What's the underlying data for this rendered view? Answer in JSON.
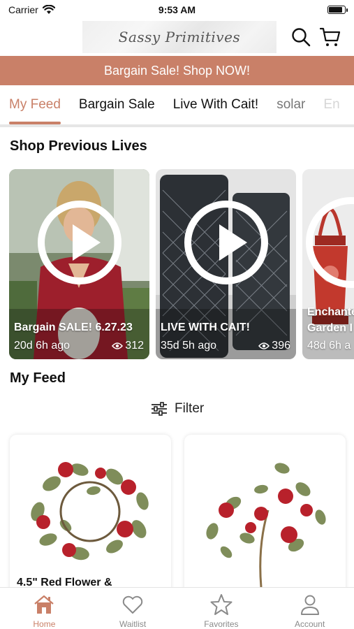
{
  "status_bar": {
    "carrier": "Carrier",
    "time": "9:53 AM",
    "battery_level": 0.9
  },
  "header": {
    "logo_text": "Sassy Primitives"
  },
  "banner": {
    "text": "Bargain Sale! Shop NOW!"
  },
  "tabs": [
    {
      "label": "My Feed",
      "active": true
    },
    {
      "label": "Bargain Sale"
    },
    {
      "label": "Live With Cait!"
    },
    {
      "label": "solar"
    },
    {
      "label": "En"
    }
  ],
  "previous_lives": {
    "title": "Shop Previous Lives",
    "items": [
      {
        "title": "Bargain SALE! 6.27.23",
        "age": "20d 6h ago",
        "views": "312"
      },
      {
        "title": "LIVE WITH CAIT!",
        "age": "35d 5h ago",
        "views": "396"
      },
      {
        "title": "Enchante",
        "title2": "Garden I",
        "age": "48d 6h a"
      }
    ]
  },
  "feed": {
    "title": "My Feed",
    "filter_label": "Filter",
    "products": [
      {
        "name": "4.5\" Red Flower &"
      },
      {
        "name": ""
      }
    ]
  },
  "bottom_nav": [
    {
      "label": "Home",
      "icon": "home-icon",
      "active": true
    },
    {
      "label": "Waitlist",
      "icon": "heart-icon"
    },
    {
      "label": "Favorites",
      "icon": "star-icon"
    },
    {
      "label": "Account",
      "icon": "person-icon"
    }
  ],
  "colors": {
    "accent": "#c98068",
    "banner": "#c98068",
    "text": "#111111"
  }
}
